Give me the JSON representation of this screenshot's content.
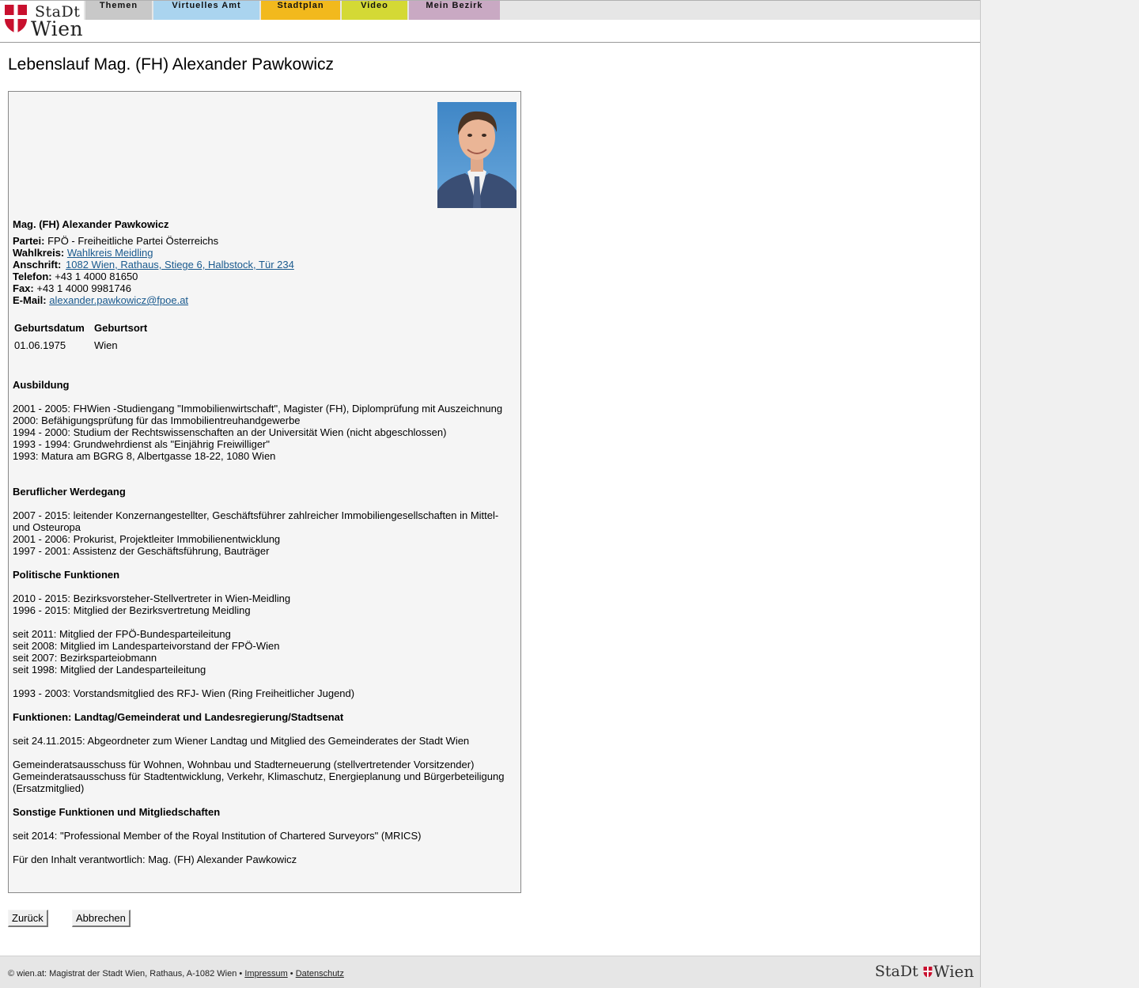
{
  "header": {
    "logo_line1": "StaDt",
    "logo_line2": "Wien",
    "tabs": [
      {
        "label": "Themen",
        "color": "#c8c8c8"
      },
      {
        "label": "Virtuelles Amt",
        "color": "#aad4ef"
      },
      {
        "label": "Stadtplan",
        "color": "#f2b91d"
      },
      {
        "label": "Video",
        "color": "#d4d935"
      },
      {
        "label": "Mein Bezirk",
        "color": "#c9a9c3"
      }
    ]
  },
  "page_title": "Lebenslauf Mag. (FH) Alexander Pawkowicz",
  "profile": {
    "name": "Mag. (FH) Alexander Pawkowicz",
    "partei_label": "Partei:",
    "partei": "FPÖ - Freiheitliche Partei Österreichs",
    "wahlkreis_label": "Wahlkreis:",
    "wahlkreis": "Wahlkreis Meidling",
    "anschrift_label": "Anschrift:",
    "anschrift": "1082 Wien, Rathaus, Stiege 6, Halbstock, Tür 234",
    "telefon_label": "Telefon:",
    "telefon": "+43 1 4000 81650",
    "fax_label": "Fax:",
    "fax": "+43 1 4000 9981746",
    "email_label": "E-Mail:",
    "email": "alexander.pawkowicz@fpoe.at"
  },
  "birth_table": {
    "headers": [
      "Geburtsdatum",
      "Geburtsort"
    ],
    "row": [
      "01.06.1975",
      "Wien"
    ]
  },
  "sections": {
    "ausbildung_heading": "Ausbildung",
    "ausbildung": [
      "2001 - 2005: FHWien -Studiengang \"Immobilienwirtschaft\", Magister (FH), Diplomprüfung mit Auszeichnung",
      "2000: Befähigungsprüfung für das Immobilientreuhandgewerbe",
      "1994 - 2000: Studium der Rechtswissenschaften an der Universität Wien (nicht abgeschlossen)",
      "1993 - 1994: Grundwehrdienst als \"Einjährig Freiwilliger\"",
      "1993: Matura am BGRG 8, Albertgasse 18-22, 1080 Wien"
    ],
    "beruf_heading": "Beruflicher Werdegang",
    "beruf": [
      "2007 - 2015: leitender Konzernangestellter, Geschäftsführer zahlreicher Immobiliengesellschaften in Mittel- und Osteuropa",
      "2001 - 2006: Prokurist, Projektleiter Immobilienentwicklung",
      "1997 - 2001: Assistenz der Geschäftsführung, Bauträger"
    ],
    "politik_heading": "Politische Funktionen",
    "politik_a": [
      "2010 - 2015: Bezirksvorsteher-Stellvertreter in Wien-Meidling",
      "1996 - 2015: Mitglied der Bezirksvertretung Meidling"
    ],
    "politik_b": [
      "seit 2011: Mitglied der FPÖ-Bundesparteileitung",
      "seit 2008: Mitglied im Landesparteivorstand der FPÖ-Wien",
      "seit 2007: Bezirksparteiobmann",
      "seit 1998: Mitglied der Landesparteileitung"
    ],
    "politik_c": "1993 - 2003: Vorstandsmitglied des RFJ- Wien (Ring Freiheitlicher Jugend)",
    "funktionen_heading": "Funktionen: Landtag/Gemeinderat und Landesregierung/Stadtsenat",
    "funktionen_a": "seit 24.11.2015: Abgeordneter zum Wiener Landtag und Mitglied des Gemeinderates der Stadt Wien",
    "funktionen_b": [
      "Gemeinderatsausschuss für Wohnen, Wohnbau und Stadterneuerung (stellvertretender Vorsitzender)",
      "Gemeinderatsausschuss für Stadtentwicklung, Verkehr, Klimaschutz, Energieplanung und Bürgerbeteiligung (Ersatzmitglied)"
    ],
    "sonstige_heading": "Sonstige Funktionen und Mitgliedschaften",
    "sonstige": "seit 2014: \"Professional Member of the Royal Institution of Chartered Surveyors\" (MRICS)",
    "verantwortlich": "Für den Inhalt verantwortlich: Mag. (FH) Alexander Pawkowicz"
  },
  "buttons": {
    "back": "Zurück",
    "cancel": "Abbrechen"
  },
  "footer": {
    "copyright": "© wien.at: Magistrat der Stadt Wien, Rathaus, A-1082 Wien •",
    "impressum": "Impressum",
    "sep": "•",
    "datenschutz": "Datenschutz",
    "logo_text_left": "StaDt",
    "logo_text_right": "Wien"
  }
}
